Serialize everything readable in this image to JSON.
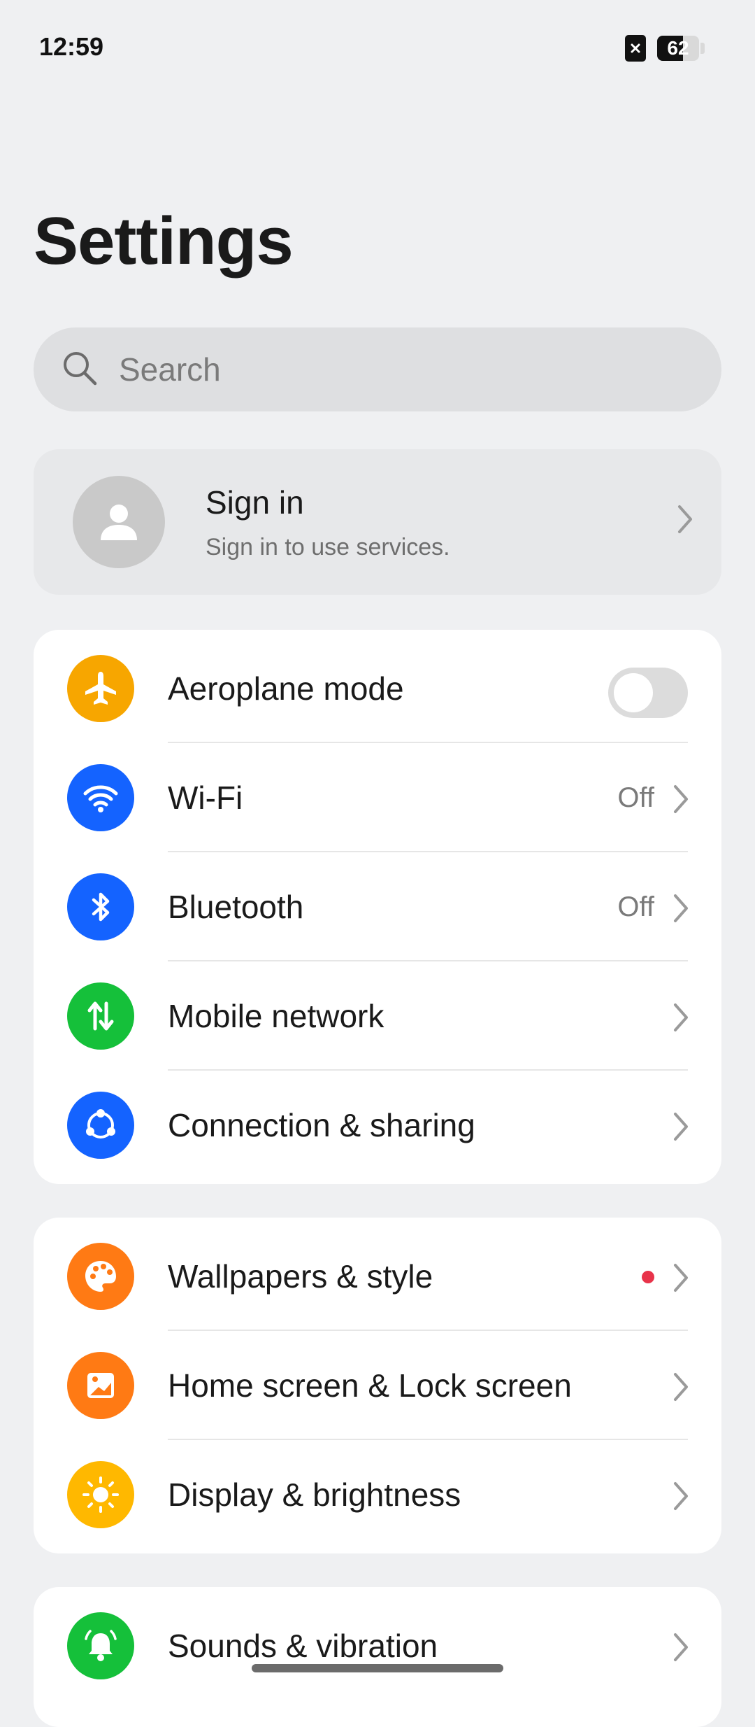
{
  "status_bar": {
    "time": "12:59",
    "battery_text": "62",
    "battery_level": 0.62
  },
  "page": {
    "title": "Settings"
  },
  "search": {
    "placeholder": "Search"
  },
  "account": {
    "title": "Sign in",
    "subtitle": "Sign in to use services."
  },
  "groups": [
    {
      "items": [
        {
          "label": "Aeroplane mode",
          "icon": "airplane-icon",
          "icon_color": "#f7a600",
          "toggle": false
        },
        {
          "label": "Wi-Fi",
          "icon": "wifi-icon",
          "icon_color": "#1463ff",
          "value": "Off"
        },
        {
          "label": "Bluetooth",
          "icon": "bluetooth-icon",
          "icon_color": "#1463ff",
          "value": "Off"
        },
        {
          "label": "Mobile network",
          "icon": "mobile-data-icon",
          "icon_color": "#15c03a"
        },
        {
          "label": "Connection & sharing",
          "icon": "share-icon",
          "icon_color": "#1463ff"
        }
      ]
    },
    {
      "items": [
        {
          "label": "Wallpapers & style",
          "icon": "palette-icon",
          "icon_color": "#ff7a14",
          "badge": "red-dot"
        },
        {
          "label": "Home screen & Lock screen",
          "icon": "home-screen-icon",
          "icon_color": "#ff7a14"
        },
        {
          "label": "Display & brightness",
          "icon": "sun-icon",
          "icon_color": "#ffb800"
        }
      ]
    },
    {
      "items": [
        {
          "label": "Sounds & vibration",
          "icon": "bell-icon",
          "icon_color": "#15c03a"
        }
      ]
    }
  ],
  "colors": {
    "background": "#eff0f2",
    "card": "#ffffff",
    "accent_blue": "#1463ff",
    "badge_red": "#e8334a"
  }
}
